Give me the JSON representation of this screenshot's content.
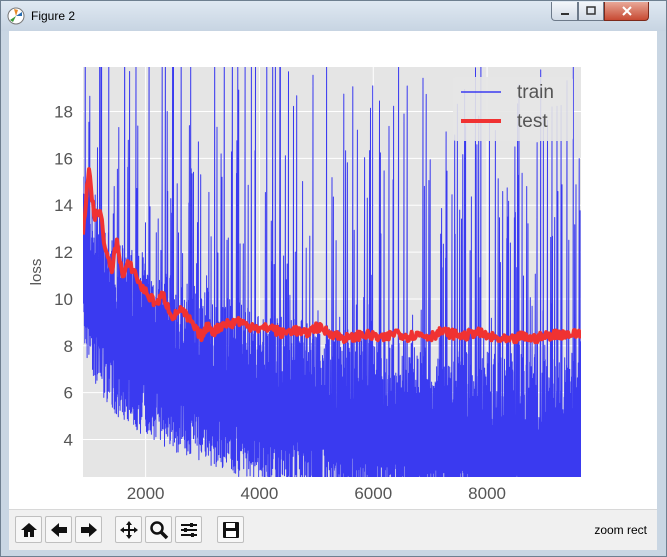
{
  "window": {
    "title": "Figure 2"
  },
  "toolbar": {
    "buttons": [
      "home-icon",
      "back-arrow-icon",
      "forward-arrow-icon",
      "pan-icon",
      "zoom-icon",
      "configure-subplots-icon",
      "save-icon"
    ],
    "status": "zoom rect"
  },
  "colors": {
    "train": "#3a3af0",
    "test": "#f03232",
    "axes_bg": "#e5e5e5",
    "grid": "#ffffff",
    "tick": "#555555"
  },
  "chart_data": {
    "type": "line",
    "title": "",
    "xlabel": "",
    "ylabel": "loss",
    "xlim": [
      900,
      9650
    ],
    "ylim": [
      2.4,
      19.9
    ],
    "xticks": [
      2000,
      4000,
      6000,
      8000
    ],
    "yticks": [
      4,
      6,
      8,
      10,
      12,
      14,
      16,
      18
    ],
    "grid": true,
    "legend_placement": "top-right",
    "series": [
      {
        "name": "train",
        "style": "thin noisy line",
        "x": [
          900,
          1000,
          1200,
          1500,
          2000,
          2500,
          3000,
          3500,
          4000,
          5000,
          6000,
          7000,
          8000,
          9000,
          9650
        ],
        "values": [
          12.0,
          11.0,
          10.0,
          9.0,
          8.0,
          7.5,
          7.0,
          6.5,
          6.0,
          5.5,
          5.0,
          4.5,
          4.3,
          4.2,
          4.2
        ]
      },
      {
        "name": "test",
        "style": "thick line",
        "x": [
          900,
          1000,
          1100,
          1200,
          1300,
          1400,
          1500,
          1600,
          1700,
          1800,
          1900,
          2000,
          2100,
          2200,
          2300,
          2400,
          2500,
          2600,
          2700,
          2800,
          2900,
          3000,
          3100,
          3200,
          3300,
          3400,
          3500,
          3600,
          3700,
          3800,
          3900,
          4000,
          4200,
          4400,
          4600,
          4800,
          5000,
          5200,
          5400,
          5600,
          5800,
          6000,
          6200,
          6400,
          6600,
          6800,
          7000,
          7200,
          7400,
          7600,
          7800,
          8000,
          8200,
          8400,
          8600,
          8800,
          9000,
          9200,
          9400,
          9650
        ],
        "values": [
          12.8,
          15.5,
          13.5,
          13.8,
          12.0,
          11.2,
          12.5,
          10.9,
          11.5,
          11.2,
          10.6,
          10.3,
          10.0,
          9.8,
          10.2,
          9.6,
          9.2,
          9.6,
          9.3,
          9.0,
          8.6,
          8.4,
          8.9,
          8.6,
          8.8,
          9.0,
          8.9,
          9.1,
          9.0,
          8.8,
          8.9,
          8.7,
          8.8,
          8.5,
          8.7,
          8.5,
          8.8,
          8.6,
          8.4,
          8.3,
          8.5,
          8.4,
          8.3,
          8.6,
          8.4,
          8.5,
          8.4,
          8.6,
          8.5,
          8.4,
          8.6,
          8.4,
          8.3,
          8.2,
          8.4,
          8.3,
          8.4,
          8.5,
          8.5,
          8.5
        ]
      }
    ]
  }
}
